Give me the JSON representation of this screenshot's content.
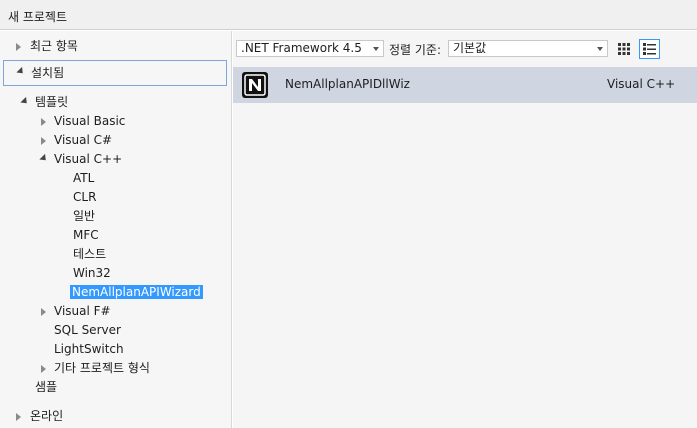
{
  "window": {
    "title": "새 프로젝트"
  },
  "tree": {
    "recent": "최근 항목",
    "installed": "설치됨",
    "templates": "템플릿",
    "languages": [
      {
        "label": "Visual Basic"
      },
      {
        "label": "Visual C#"
      },
      {
        "label": "Visual C++"
      }
    ],
    "cpp_children": [
      "ATL",
      "CLR",
      "일반",
      "MFC",
      "테스트",
      "Win32",
      "NemAllplanAPIWizard"
    ],
    "visual_fsharp": "Visual F#",
    "sql_server": "SQL Server",
    "lightswitch": "LightSwitch",
    "other_types": "기타 프로젝트 형식",
    "samples": "샘플",
    "online": "온라인"
  },
  "toolbar": {
    "framework": ".NET Framework 4.5",
    "sort_label": "정렬 기준:",
    "sort_value": "기본값"
  },
  "list": {
    "items": [
      {
        "name": "NemAllplanAPIDllWiz",
        "type": "Visual C++",
        "icon": "nem-logo-icon"
      }
    ]
  },
  "colors": {
    "selection": "#3399ff",
    "row_selected": "#cfd5e1"
  }
}
